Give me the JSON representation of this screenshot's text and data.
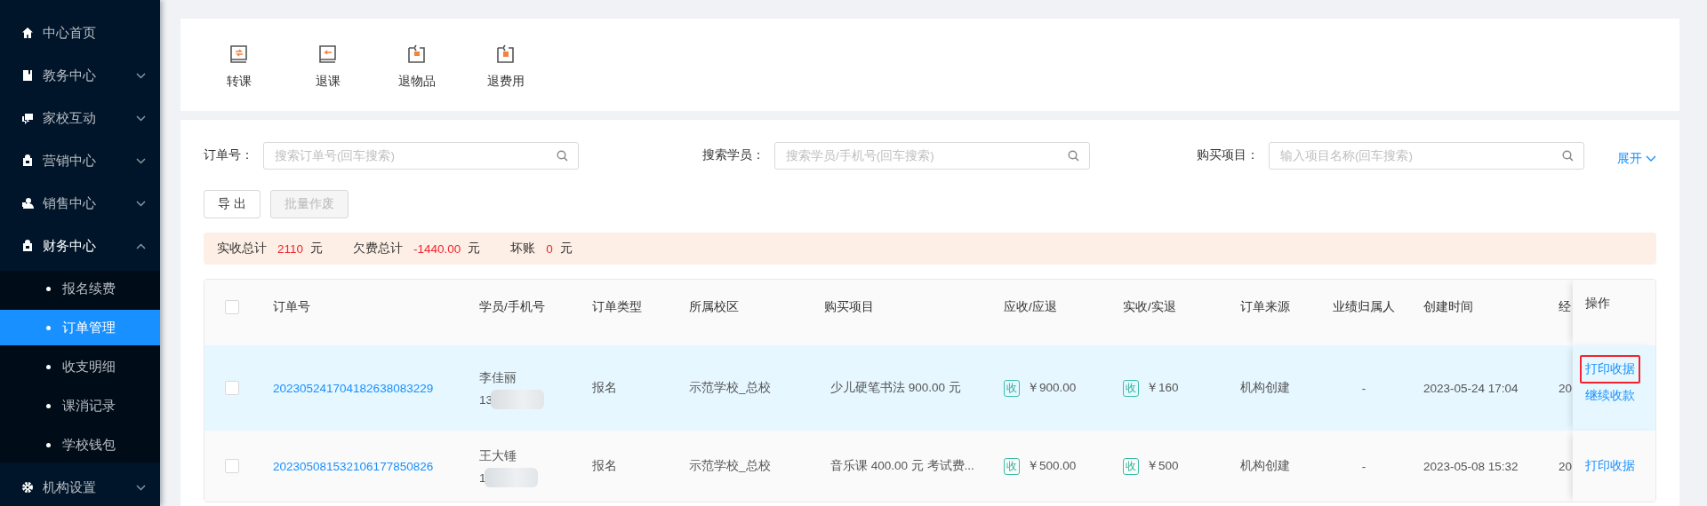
{
  "sidebar": {
    "items": [
      {
        "label": "中心首页",
        "kind": "link"
      },
      {
        "label": "教务中心",
        "kind": "group",
        "expanded": false
      },
      {
        "label": "家校互动",
        "kind": "group",
        "expanded": false
      },
      {
        "label": "营销中心",
        "kind": "group",
        "expanded": false
      },
      {
        "label": "销售中心",
        "kind": "group",
        "expanded": false
      },
      {
        "label": "财务中心",
        "kind": "group",
        "expanded": true,
        "children": [
          {
            "label": "报名续费",
            "selected": false
          },
          {
            "label": "订单管理",
            "selected": true
          },
          {
            "label": "收支明细",
            "selected": false
          },
          {
            "label": "课消记录",
            "selected": false
          },
          {
            "label": "学校钱包",
            "selected": false
          }
        ]
      },
      {
        "label": "机构设置",
        "kind": "group",
        "expanded": false
      }
    ]
  },
  "toolbar": {
    "actions": [
      {
        "label": "转课"
      },
      {
        "label": "退课"
      },
      {
        "label": "退物品"
      },
      {
        "label": "退费用"
      }
    ]
  },
  "filters": [
    {
      "label": "订单号：",
      "placeholder": "搜索订单号(回车搜索)"
    },
    {
      "label": "搜索学员：",
      "placeholder": "搜索学员/手机号(回车搜索)"
    },
    {
      "label": "购买项目：",
      "placeholder": "输入项目名称(回车搜索)"
    }
  ],
  "expand_link": "展开",
  "buttons": [
    {
      "label": "导 出",
      "disabled": false
    },
    {
      "label": "批量作废",
      "disabled": true
    }
  ],
  "summary": [
    {
      "label": "实收总计",
      "value": "2110",
      "unit": "元"
    },
    {
      "label": "欠费总计",
      "value": "-1440.00",
      "unit": "元"
    },
    {
      "label": "坏账",
      "value": "0",
      "unit": "元"
    }
  ],
  "table": {
    "header_checked": false,
    "columns": [
      "订单号",
      "学员/手机号",
      "订单类型",
      "所属校区",
      "购买项目",
      "应收/应退",
      "实收/实退",
      "订单来源",
      "业绩归属人",
      "创建时间",
      "经",
      "操作"
    ],
    "rows": [
      {
        "checked": false,
        "hovered": true,
        "order_no": "202305241704182638083229",
        "student": "李佳丽",
        "phone": "13",
        "type": "报名",
        "campus": "示范学校_总校",
        "items": "少儿硬笔书法 900.00 元",
        "receivable": {
          "tag": "收",
          "amount": "￥900.00"
        },
        "received": {
          "tag": "收",
          "amount": "￥160"
        },
        "source": "机构创建",
        "owner": "-",
        "created": "2023-05-24 17:04",
        "column_11": "20",
        "actions": [
          {
            "label": "打印收据",
            "highlighted": true
          },
          {
            "label": "继续收款",
            "highlighted": false
          }
        ]
      },
      {
        "checked": false,
        "hovered": false,
        "order_no": "202305081532106177850826",
        "student": "王大锤",
        "phone": "1",
        "type": "报名",
        "campus": "示范学校_总校",
        "items": "音乐课 400.00 元 考试费...",
        "receivable": {
          "tag": "收",
          "amount": "￥500.00"
        },
        "received": {
          "tag": "收",
          "amount": "￥500"
        },
        "source": "机构创建",
        "owner": "-",
        "created": "2023-05-08 15:32",
        "column_11": "20",
        "actions": [
          {
            "label": "打印收据",
            "highlighted": false
          }
        ]
      }
    ]
  }
}
